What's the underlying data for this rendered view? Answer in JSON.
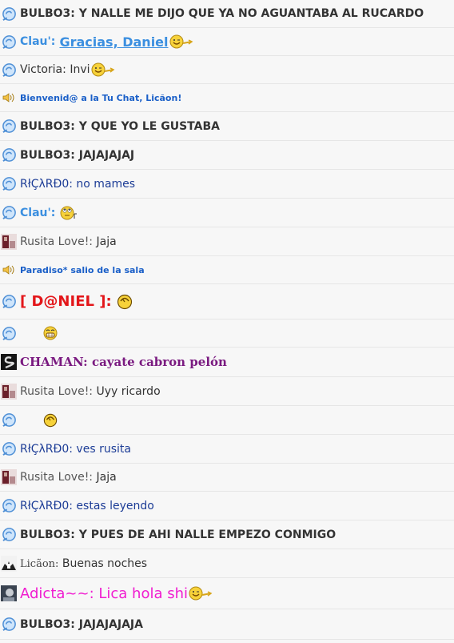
{
  "messages": [
    {
      "user": "BULBO3:",
      "text": "Y NALLE ME DIJO QUE YA NO AGUANTABA AL RUCARDO"
    },
    {
      "user": "Clau':",
      "text": "Gracias, Daniel",
      "emoticon": "wink-pointing-emoticon"
    },
    {
      "user": "Victoria:",
      "text": "Invi",
      "emoticon": "wink-pointing-emoticon"
    },
    {
      "text": "Bienvenid@ a la Tu Chat, Licãon!",
      "icon": "speaker-icon"
    },
    {
      "user": "BULBO3:",
      "text": "Y QUE YO LE GUSTABA"
    },
    {
      "user": "BULBO3:",
      "text": "JAJAJAJAJ"
    },
    {
      "user": "RłÇλRĐ0:",
      "text": "no mames"
    },
    {
      "user": "Clau':",
      "text": "",
      "emoticon": "rolling-eyes-emoticon"
    },
    {
      "user": "Rusita Love!:",
      "text": "Jaja"
    },
    {
      "text": "Paradiso* salio de la sala",
      "icon": "speaker-icon"
    },
    {
      "user": "[ D@NIEL ]:",
      "text": "",
      "emoticon": "laughing-emoticon"
    },
    {
      "user": "",
      "text": "",
      "emoticon": "grin-emoticon"
    },
    {
      "user": "CHAMAN:",
      "text": "cayate cabron pelón"
    },
    {
      "user": "Rusita Love!:",
      "text": "Uyy ricardo"
    },
    {
      "user": "",
      "text": "",
      "emoticon": "laughing-emoticon"
    },
    {
      "user": "RłÇλRĐ0:",
      "text": "ves rusita"
    },
    {
      "user": "Rusita Love!:",
      "text": "Jaja"
    },
    {
      "user": "RłÇλRĐ0:",
      "text": "estas leyendo"
    },
    {
      "user": "BULBO3:",
      "text": "Y PUES DE AHI NALLE EMPEZO CONMIGO"
    },
    {
      "user": "Licãon:",
      "text": "Buenas noches"
    },
    {
      "user": "Adicta~~:",
      "text": "Lica hola shi",
      "emoticon": "wink-pointing-emoticon"
    },
    {
      "user": "BULBO3:",
      "text": "JAJAJAJAJA"
    }
  ]
}
